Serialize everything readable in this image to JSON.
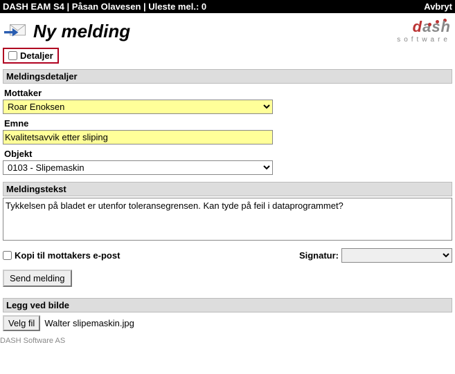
{
  "topbar": {
    "title": "DASH EAM S4 | Påsan Olavesen | Uleste mel.: 0",
    "cancel": "Avbryt"
  },
  "header": {
    "title": "Ny melding",
    "logo_main": "dash",
    "logo_sub": "software"
  },
  "details": {
    "label": "Detaljer",
    "checked": false
  },
  "sections": {
    "message_details": "Meldingsdetaljer",
    "message_text": "Meldingstekst",
    "attach_image": "Legg ved bilde"
  },
  "fields": {
    "recipient": {
      "label": "Mottaker",
      "value": "Roar Enoksen"
    },
    "subject": {
      "label": "Emne",
      "value": "Kvalitetsavvik etter sliping"
    },
    "object": {
      "label": "Objekt",
      "value": "0103 - Slipemaskin"
    },
    "body": {
      "value": "Tykkelsen på bladet er utenfor toleransegrensen. Kan tyde på feil i dataprogrammet?"
    }
  },
  "options": {
    "copy_email": "Kopi til mottakers e-post",
    "signature_label": "Signatur:",
    "signature_value": ""
  },
  "buttons": {
    "send": "Send melding",
    "choose_file": "Velg fil"
  },
  "attachment": {
    "filename": "Walter slipemaskin.jpg"
  },
  "footer": "DASH Software AS"
}
